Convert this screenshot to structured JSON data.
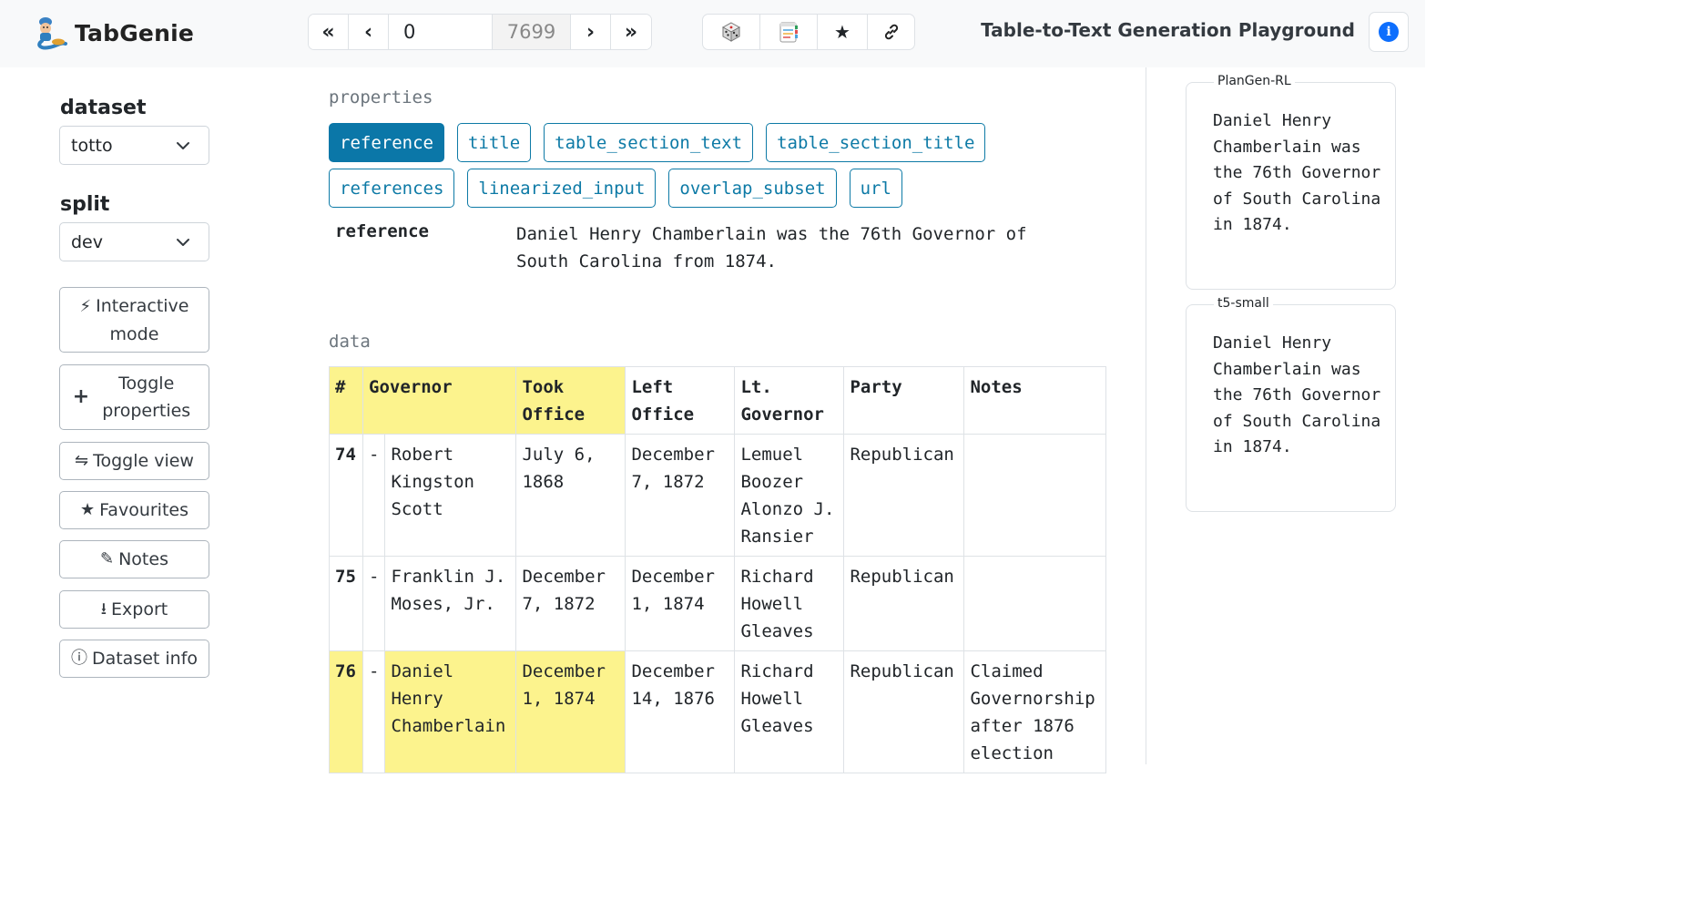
{
  "header": {
    "brand": "TabGenie",
    "nav": {
      "first": "«",
      "prev": "‹",
      "current_index": "0",
      "total": "7699",
      "next": "›",
      "last": "»"
    },
    "app_title": "Table-to-Text Generation Playground"
  },
  "sidebar": {
    "dataset_label": "dataset",
    "dataset_value": "totto",
    "split_label": "split",
    "split_value": "dev",
    "buttons": {
      "interactive": {
        "icon": "⚡",
        "label1": "Interactive",
        "label2": "mode"
      },
      "toggle_props": {
        "icon": "+",
        "label1": "Toggle",
        "label2": "properties"
      },
      "toggle_view": {
        "icon": "⇋",
        "label": "Toggle view"
      },
      "favourites": {
        "icon": "★",
        "label": "Favourites"
      },
      "notes": {
        "icon": "✎",
        "label": "Notes"
      },
      "export": {
        "icon": "⭳",
        "label": "Export"
      },
      "dataset_info": {
        "icon": "ⓘ",
        "label": "Dataset info"
      }
    }
  },
  "main": {
    "properties_title": "properties",
    "properties": [
      "reference",
      "title",
      "table_section_text",
      "table_section_title",
      "references",
      "linearized_input",
      "overlap_subset",
      "url"
    ],
    "active_property": "reference",
    "reference_key": "reference",
    "reference_value": "Daniel Henry Chamberlain was the 76th Governor of South Carolina from 1874.",
    "data_title": "data",
    "table": {
      "headers": {
        "num": "#",
        "governor": "Governor",
        "took": "Took Office",
        "left": "Left Office",
        "lt": "Lt. Governor",
        "party": "Party",
        "notes": "Notes"
      },
      "rows": [
        {
          "num": "74",
          "dash": "-",
          "governor": "Robert Kingston Scott",
          "took": "July 6, 1868",
          "left": "December 7, 1872",
          "lt": "Lemuel Boozer Alonzo J. Ransier",
          "party": "Republican",
          "notes": ""
        },
        {
          "num": "75",
          "dash": "-",
          "governor": "Franklin J. Moses, Jr.",
          "took": "December 7, 1872",
          "left": "December 1, 1874",
          "lt": "Richard Howell Gleaves",
          "party": "Republican",
          "notes": ""
        },
        {
          "num": "76",
          "dash": "-",
          "governor": "Daniel Henry Chamberlain",
          "took": "December 1, 1874",
          "left": "December 14, 1876",
          "lt": "Richard Howell Gleaves",
          "party": "Republican",
          "notes": "Claimed Governorship after 1876 election"
        }
      ]
    }
  },
  "outputs": [
    {
      "model": "PlanGen-RL",
      "text": "Daniel Henry Chamberlain was the 76th Governor of South Carolina in 1874."
    },
    {
      "model": "t5-small",
      "text": "Daniel Henry Chamberlain was the 76th Governor of South Carolina in 1874."
    }
  ],
  "icons": {
    "random": "dice-icon",
    "notes": "notepad-icon",
    "favourite": "star-icon",
    "link": "link-icon",
    "info": "info-icon"
  },
  "colors": {
    "accent": "#0b77a8",
    "highlight": "#fcf38d",
    "info": "#0d6efd"
  }
}
